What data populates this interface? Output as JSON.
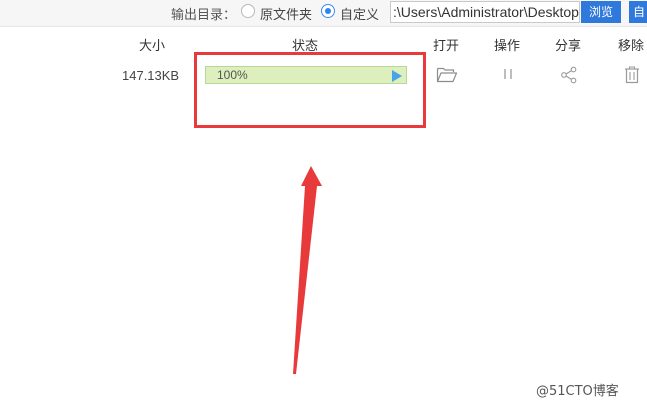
{
  "output_bar": {
    "label": "输出目录：",
    "option_original": "原文件夹",
    "option_custom": "自定义",
    "selected_option": "自定义",
    "path_value": ":\\Users\\Administrator\\Desktop",
    "browse_button": "浏览",
    "open_button": "自"
  },
  "table": {
    "headers": {
      "size": "大小",
      "status": "状态",
      "open": "打开",
      "operation": "操作",
      "share": "分享",
      "remove": "移除"
    },
    "rows": [
      {
        "size": "147.13KB",
        "progress_text": "100%",
        "progress": 1.0
      }
    ]
  },
  "icons": {
    "play": "play-icon",
    "open": "folder-icon",
    "operation": "pause-icon",
    "share": "share-icon",
    "remove": "trash-icon"
  },
  "colors": {
    "accent": "#2f79dd",
    "progress_fill": "#dcefbd",
    "progress_border": "#b8d89a",
    "annotation": "#e83a3a"
  },
  "watermark": "@51CTO博客"
}
